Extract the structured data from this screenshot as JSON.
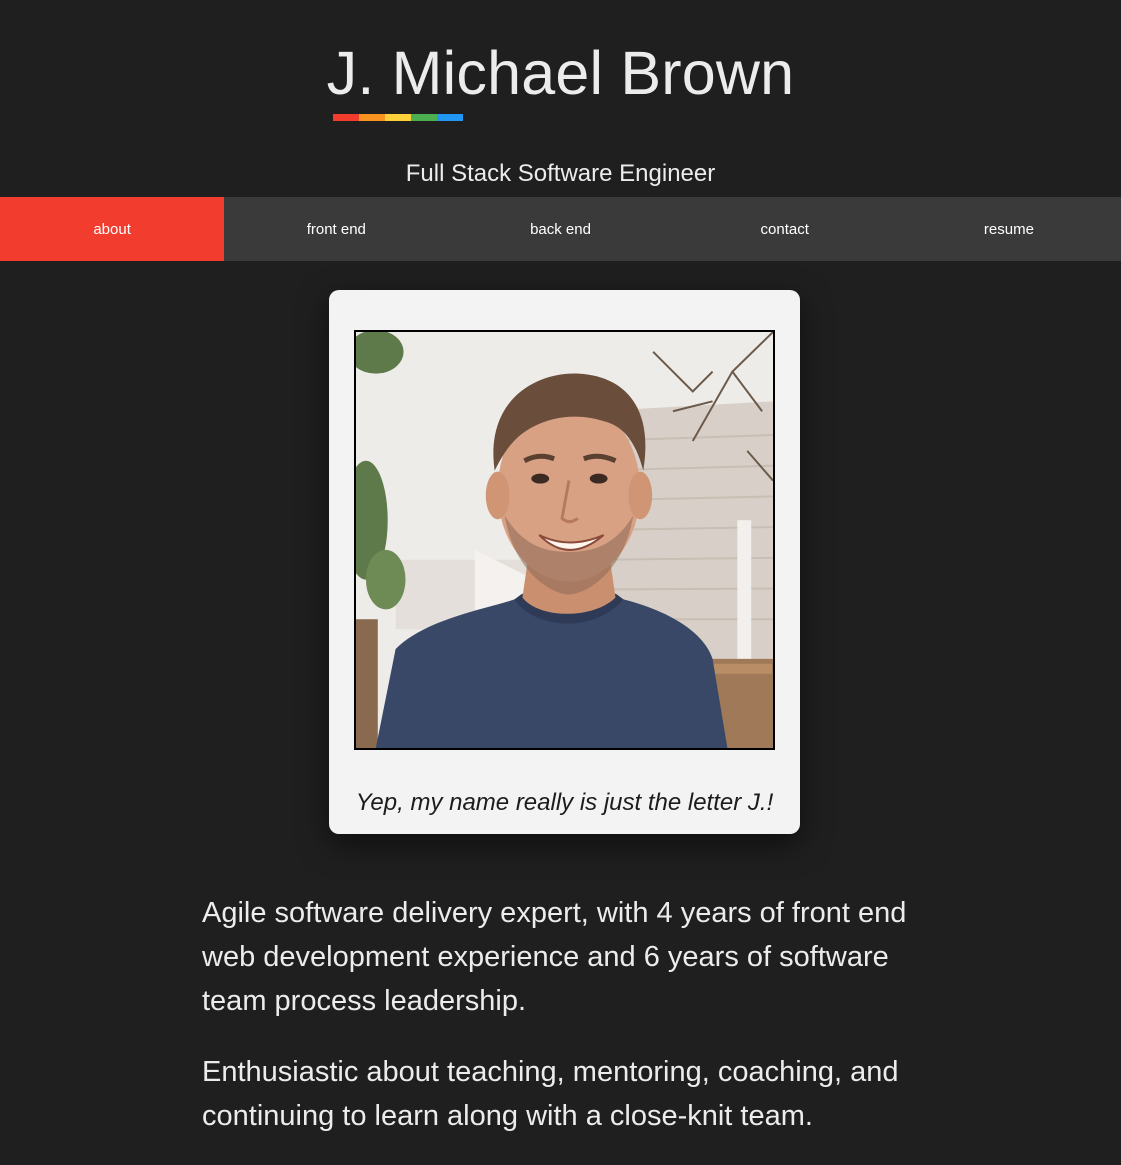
{
  "header": {
    "title": "J. Michael Brown",
    "subtitle": "Full Stack Software Engineer",
    "accent_colors": [
      "#f23c2e",
      "#f7931e",
      "#fbd03b",
      "#4caf50",
      "#2196f3"
    ]
  },
  "nav": {
    "items": [
      {
        "label": "about",
        "active": true
      },
      {
        "label": "front end",
        "active": false
      },
      {
        "label": "back end",
        "active": false
      },
      {
        "label": "contact",
        "active": false
      },
      {
        "label": "resume",
        "active": false
      }
    ],
    "active_color": "#f23c2e"
  },
  "profile_card": {
    "caption": "Yep, my name really is just the letter J.!"
  },
  "bio": {
    "paragraphs": [
      "Agile software delivery expert, with 4 years of front end web development experience and 6 years of software team process leadership.",
      "Enthusiastic about teaching, mentoring, coaching, and continuing to learn along with a close-knit team."
    ]
  }
}
